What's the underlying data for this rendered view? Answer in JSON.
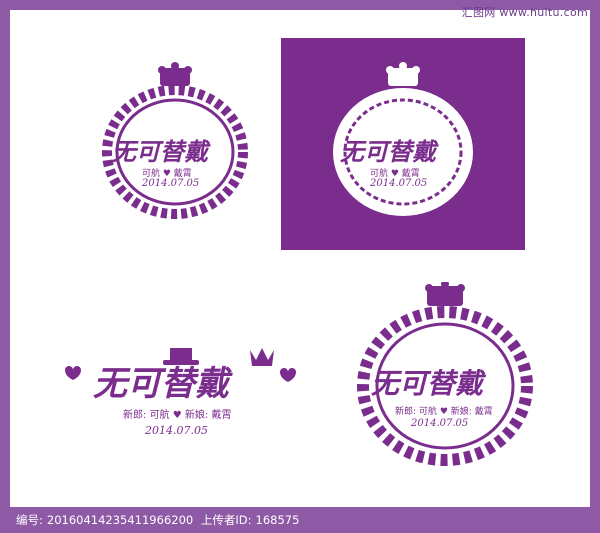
{
  "watermark": {
    "site": "汇图网 www.huitu.com"
  },
  "logo": {
    "title": "无可替戴",
    "names_short": "可航 ♥ 戴霄",
    "names_long_groom_label": "新郎:",
    "groom": "可航",
    "bride_label": "新娘:",
    "bride": "戴霄",
    "date": "2014.07.05"
  },
  "footer": {
    "id_label": "编号:",
    "id_value": "20160414235411966200",
    "uploader_label": "上传者ID:",
    "uploader_value": "168575"
  },
  "colors": {
    "brand_purple": "#7b2d8e",
    "frame_purple": "#8e5aa5"
  }
}
